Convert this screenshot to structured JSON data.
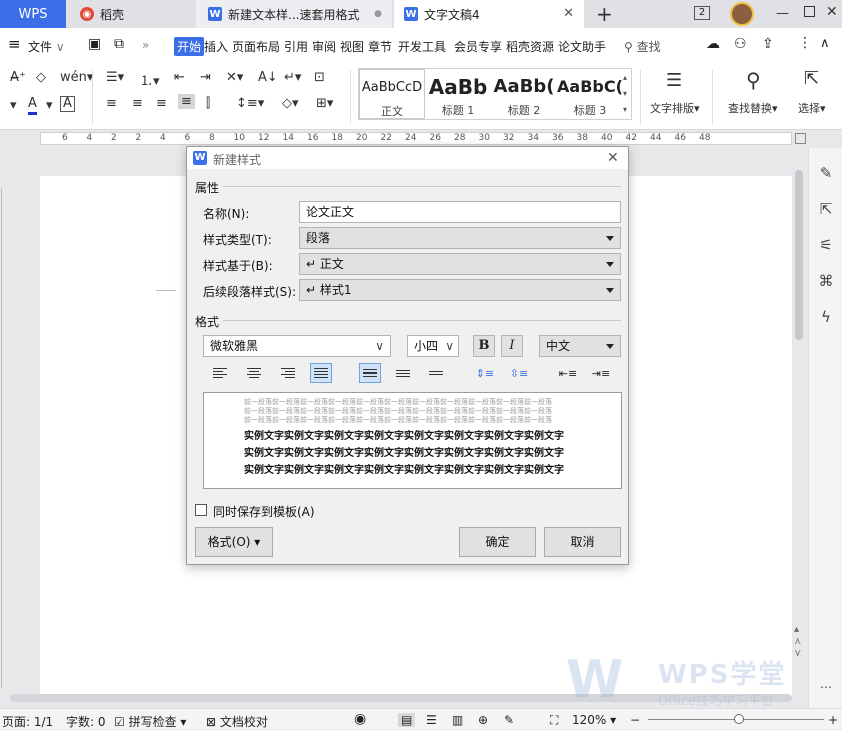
{
  "tabs": {
    "wps": "WPS",
    "daoke": "稻壳",
    "doc1": "新建文本样...速套用格式",
    "doc2": "文字文稿4",
    "add": "+",
    "page_badge": "2"
  },
  "menu": {
    "file": "文件",
    "items": [
      "开始",
      "插入",
      "页面布局",
      "引用",
      "审阅",
      "视图",
      "章节",
      "开发工具",
      "会员专享",
      "稻壳资源",
      "论文助手"
    ],
    "search": "查找"
  },
  "ribbon": {
    "styles": [
      {
        "preview": "AaBbCcD",
        "name": "正文"
      },
      {
        "preview": "AaBb",
        "name": "标题 1"
      },
      {
        "preview": "AaBb(",
        "name": "标题 2"
      },
      {
        "preview": "AaBbC(",
        "name": "标题 3"
      }
    ],
    "text_layout": "文字排版",
    "find_replace": "查找替换",
    "select": "选择"
  },
  "ruler": {
    "ticks": [
      "6",
      "4",
      "2",
      "2",
      "4",
      "6",
      "8",
      "10",
      "12",
      "14",
      "16",
      "18",
      "20",
      "22",
      "24",
      "26",
      "28",
      "30",
      "32",
      "34",
      "36",
      "38",
      "40",
      "42",
      "44",
      "46",
      "48"
    ]
  },
  "dialog": {
    "title": "新建样式",
    "properties_header": "属性",
    "name_label": "名称(N):",
    "name_value": "论文正文",
    "style_type_label": "样式类型(T):",
    "style_type_value": "段落",
    "based_on_label": "样式基于(B):",
    "based_on_value": "↵ 正文",
    "next_style_label": "后续段落样式(S):",
    "next_style_value": "↵ 样式1",
    "format_header": "格式",
    "font_value": "微软雅黑",
    "size_value": "小四",
    "bold": "B",
    "italic": "I",
    "script_value": "中文",
    "preview_prev_line": "前一段落前一段落前一段落前一段落前一段落前一段落前一段落前一段落前一段落前一段落前一段落",
    "preview_sample_line": "实例文字实例文字实例文字实例文字实例文字实例文字实例文字实例文字",
    "save_to_template": "同时保存到模板(A)",
    "format_button": "格式(O)",
    "ok_button": "确定",
    "cancel_button": "取消"
  },
  "status": {
    "page": "页面: 1/1",
    "words": "字数: 0",
    "spell": "拼写检查",
    "proof": "文档校对",
    "zoom": "120%"
  },
  "watermark": {
    "brand": "WPS学堂",
    "sub": "Office技巧学习平台"
  },
  "colors": {
    "accent": "#3a6fe8",
    "selection": "#cfe2f7"
  }
}
